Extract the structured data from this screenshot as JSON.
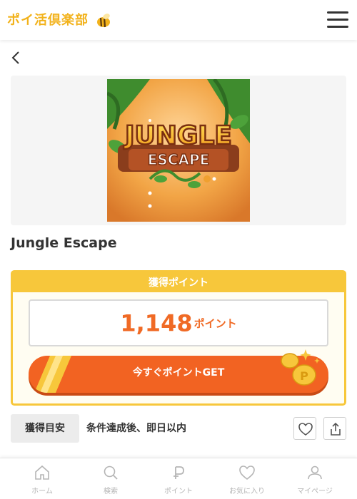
{
  "header": {
    "logo_text": "ポイ活倶楽部",
    "menu_icon": "hamburger-menu-icon"
  },
  "nav": {
    "back_icon": "chevron-left-icon"
  },
  "hero": {
    "image_text_line1": "JUNGLE",
    "image_text_line2": "ESCAPE"
  },
  "app": {
    "title": "Jungle Escape"
  },
  "points": {
    "header": "獲得ポイント",
    "value": "1,148",
    "unit": "ポイント",
    "button_label": "今すぐポイントGET"
  },
  "condition": {
    "tag": "獲得目安",
    "text": "条件達成後、即日以内"
  },
  "tabbar": {
    "items": [
      {
        "label": "ホーム",
        "icon": "home-icon"
      },
      {
        "label": "検索",
        "icon": "search-icon"
      },
      {
        "label": "ポイント",
        "icon": "point-icon"
      },
      {
        "label": "お気に入り",
        "icon": "heart-icon"
      },
      {
        "label": "マイページ",
        "icon": "user-icon"
      }
    ]
  },
  "colors": {
    "brand_yellow": "#f7c73b",
    "accent_orange": "#f26322",
    "points_text": "#f06a25",
    "tab_inactive": "#b5b5b5"
  }
}
